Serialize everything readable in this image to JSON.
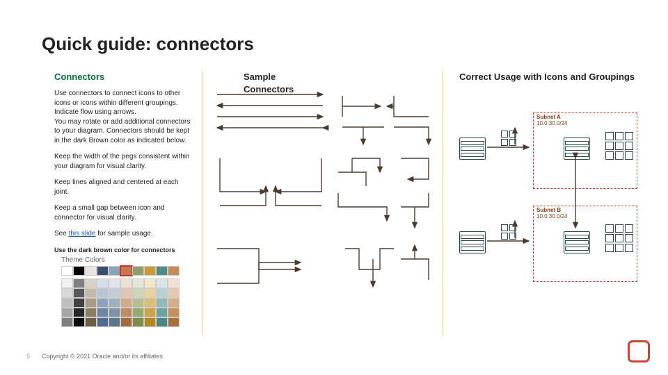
{
  "title": "Quick guide: connectors",
  "columns": {
    "left": "Connectors",
    "mid": "Sample Connectors",
    "right": "Correct Usage with Icons and Groupings"
  },
  "body": {
    "p1": "Use connectors to connect icons to other icons or icons within different groupings. Indicate flow using arrows.\nYou may rotate or add additional connectors to your diagram. Connectors should be kept in the dark Brown color as indicated below.",
    "p2": "Keep the width of the pegs consistent within your diagram for visual clarity.",
    "p3": "Keep lines aligned and centered at each joint.",
    "p4": "Keep a small gap between icon and connector for visual clarity.",
    "p5a": "See ",
    "p5link": "this slide",
    "p5b": " for sample usage.",
    "swatch_note": "Use the dark brown color for connectors",
    "theme_label": "Theme Colors"
  },
  "subnet": {
    "a_name": "Subnet A",
    "a_cidr": "10.0.30.0/24",
    "b_name": "Subnet B",
    "b_cidr": "10.0.30.0/24"
  },
  "palette": {
    "top": [
      "#ffffff",
      "#000000",
      "#e9e5dc",
      "#3a4f6e",
      "#8aa3b5",
      "#c27a55",
      "#8fa06a",
      "#c99a3a",
      "#4e8c8c",
      "#c88a57"
    ],
    "shades": [
      [
        "#f2f2f2",
        "#7f7f7f",
        "#d7d2c4",
        "#d6dde8",
        "#dde5ea",
        "#f0dfd4",
        "#e3e8d6",
        "#f3e6ca",
        "#d7e6e6",
        "#f2e1d3"
      ],
      [
        "#d9d9d9",
        "#595959",
        "#c2bba7",
        "#b7c4d6",
        "#c0cdd6",
        "#e3c6b2",
        "#cdd6b4",
        "#e9d3a1",
        "#b6d1d1",
        "#e6caae"
      ],
      [
        "#bfbfbf",
        "#404040",
        "#a79d82",
        "#8ea2bd",
        "#9db0bd",
        "#d4a98a",
        "#b4c18f",
        "#dcbd76",
        "#8fbaba",
        "#d7ad85"
      ],
      [
        "#a6a6a6",
        "#262626",
        "#8a7f60",
        "#6e86a6",
        "#7b93a3",
        "#c28a61",
        "#99ab6a",
        "#cda24c",
        "#6da0a0",
        "#c6905d"
      ],
      [
        "#7f7f7f",
        "#0d0d0d",
        "#6a5f43",
        "#4e6a8e",
        "#5b788a",
        "#a46a3f",
        "#7c8e4b",
        "#b48527",
        "#4d8585",
        "#aa6f3a"
      ]
    ],
    "highlight_idx": 5
  },
  "footer": {
    "page": "5",
    "copyright": "Copyright © 2021 Oracle and/or its affiliates"
  }
}
